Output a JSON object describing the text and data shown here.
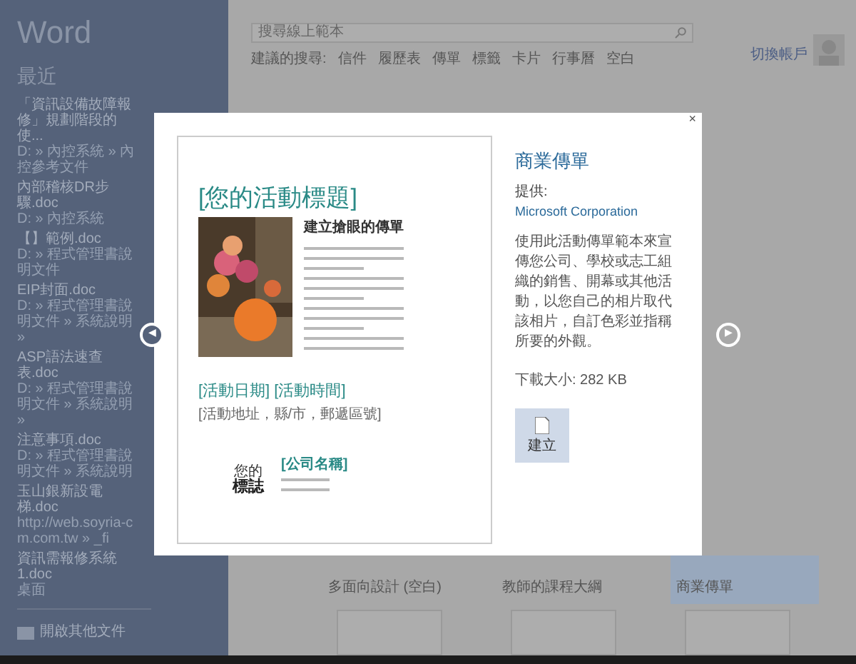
{
  "app": {
    "title": "Word"
  },
  "sidebar": {
    "heading": "最近",
    "recent": [
      {
        "name": "「資訊設備故障報修」規劃階段的使...",
        "path": "D: » 內控系統 » 內控參考文件"
      },
      {
        "name": "內部稽核DR步驟.doc",
        "path": "D: » 內控系統"
      },
      {
        "name": "【】範例.doc",
        "path": "D: » 程式管理書說明文件"
      },
      {
        "name": "EIP封面.doc",
        "path": "D: » 程式管理書說明文件 » 系統說明 »"
      },
      {
        "name": "ASP語法速查表.doc",
        "path": "D: » 程式管理書說明文件 » 系統說明 »"
      },
      {
        "name": "注意事項.doc",
        "path": "D: » 程式管理書說明文件 » 系統說明"
      },
      {
        "name": "玉山銀新設電梯.doc",
        "path": "http://web.soyria-cm.com.tw » _fi"
      },
      {
        "name": "資訊需報修系統1.doc",
        "path": "桌面"
      }
    ],
    "open_other": "開啟其他文件"
  },
  "search": {
    "placeholder": "搜尋線上範本"
  },
  "categories": [
    "建議的搜尋:",
    "信件",
    "履歷表",
    "傳單",
    "標籤",
    "卡片",
    "行事曆",
    "空白"
  ],
  "account": {
    "switch": "切換帳戶"
  },
  "templates": [
    {
      "name": "多面向設計 (空白)",
      "selected": false
    },
    {
      "name": "教師的課程大綱",
      "selected": false
    },
    {
      "name": "商業傳單",
      "selected": true
    }
  ],
  "dialog": {
    "close": "×",
    "prev": "◀",
    "next": "▶",
    "preview": {
      "title": "[您的活動標題]",
      "subtitle": "建立搶眼的傳單",
      "date": "[活動日期] [活動時間]",
      "address": "[活動地址，縣/市，郵遞區號]",
      "logo_small": "您的",
      "logo": "標誌",
      "company": "[公司名稱]"
    },
    "name": "商業傳單",
    "provider_label": "提供:",
    "provider": "Microsoft Corporation",
    "description": "使用此活動傳單範本來宣傳您公司、學校或志工組織的銷售、開幕或其他活動，以您自己的相片取代該相片，自訂色彩並指稱所要的外觀。",
    "size": "下載大小: 282 KB",
    "create": "建立"
  }
}
